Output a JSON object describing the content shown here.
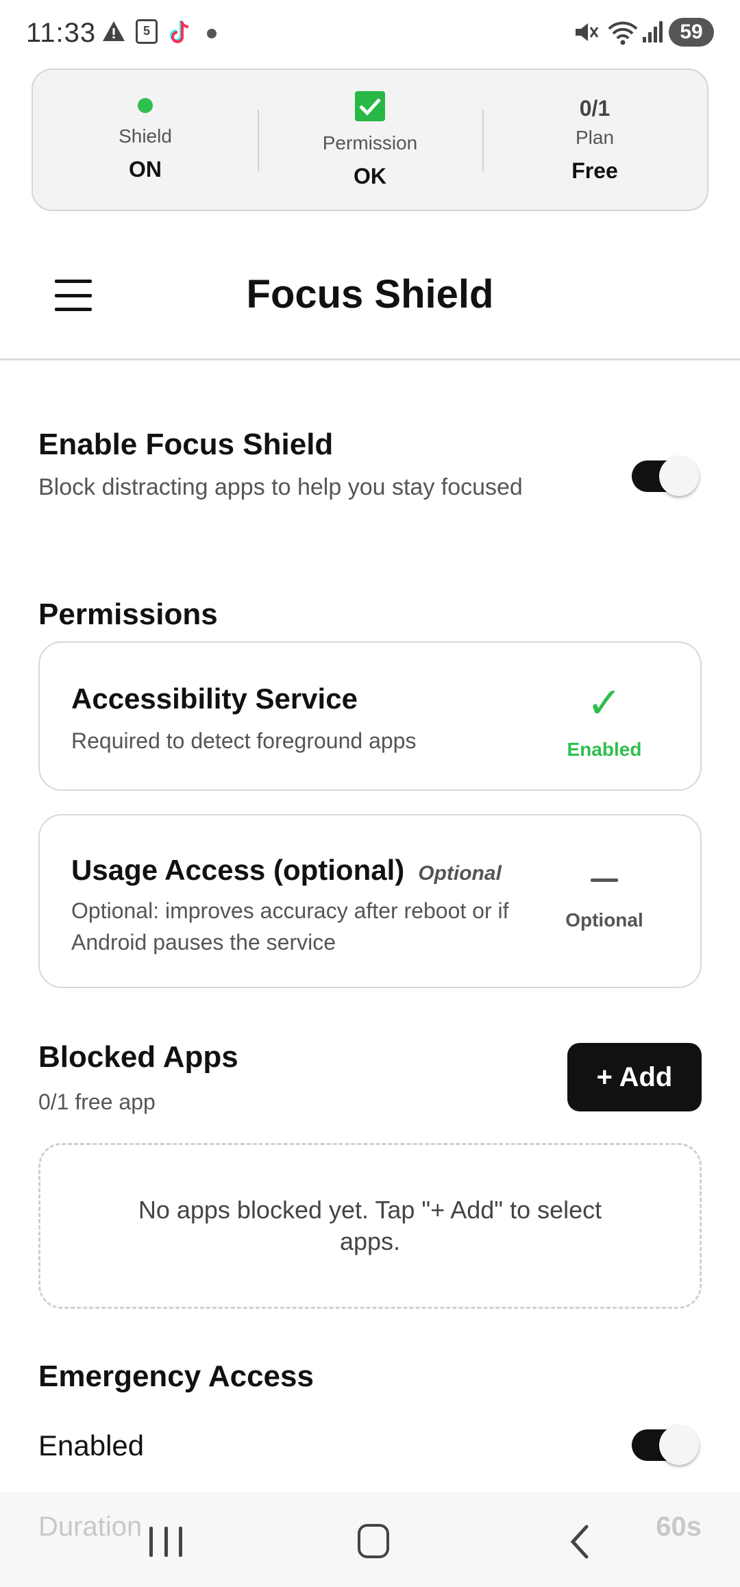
{
  "status_bar": {
    "time": "11:33",
    "calendar_day": "5",
    "battery": "59",
    "icons": [
      "warning-icon",
      "calendar-icon",
      "tiktok-icon",
      "dot-icon",
      "mute-icon",
      "wifi-icon",
      "signal-icon",
      "battery-icon"
    ]
  },
  "stats": {
    "shield": {
      "label": "Shield",
      "value": "ON",
      "color": "#2fbf4f"
    },
    "permission": {
      "label": "Permission",
      "value": "OK",
      "color": "#28b845"
    },
    "plan": {
      "count": "0/1",
      "label": "Plan",
      "value": "Free"
    }
  },
  "app_bar": {
    "title": "Focus Shield",
    "menu_icon": "hamburger-menu-icon"
  },
  "enable": {
    "title": "Enable Focus Shield",
    "subtitle": "Block distracting apps to help you stay focused",
    "toggle_on": true
  },
  "permissions": {
    "title": "Permissions",
    "items": [
      {
        "name": "Accessibility Service",
        "description": "Required to detect foreground apps",
        "status": "Enabled",
        "status_icon": "check-icon",
        "status_color": "#2fbf4f"
      },
      {
        "name": "Usage Access (optional)",
        "tag": "Optional",
        "description": "Optional: improves accuracy after reboot or if Android pauses the service",
        "status": "Optional",
        "status_icon": "dash-icon"
      }
    ]
  },
  "blocked_apps": {
    "title": "Blocked Apps",
    "subtitle": "0/1 free app",
    "add_label": "+ Add",
    "empty_text": "No apps blocked yet. Tap \"+ Add\" to select apps."
  },
  "emergency": {
    "title": "Emergency Access",
    "enabled_label": "Enabled",
    "toggle_on": true,
    "duration_label": "Duration",
    "duration_value": "60s"
  },
  "nav": {
    "icons": [
      "recent-apps-icon",
      "home-icon",
      "back-icon"
    ]
  }
}
